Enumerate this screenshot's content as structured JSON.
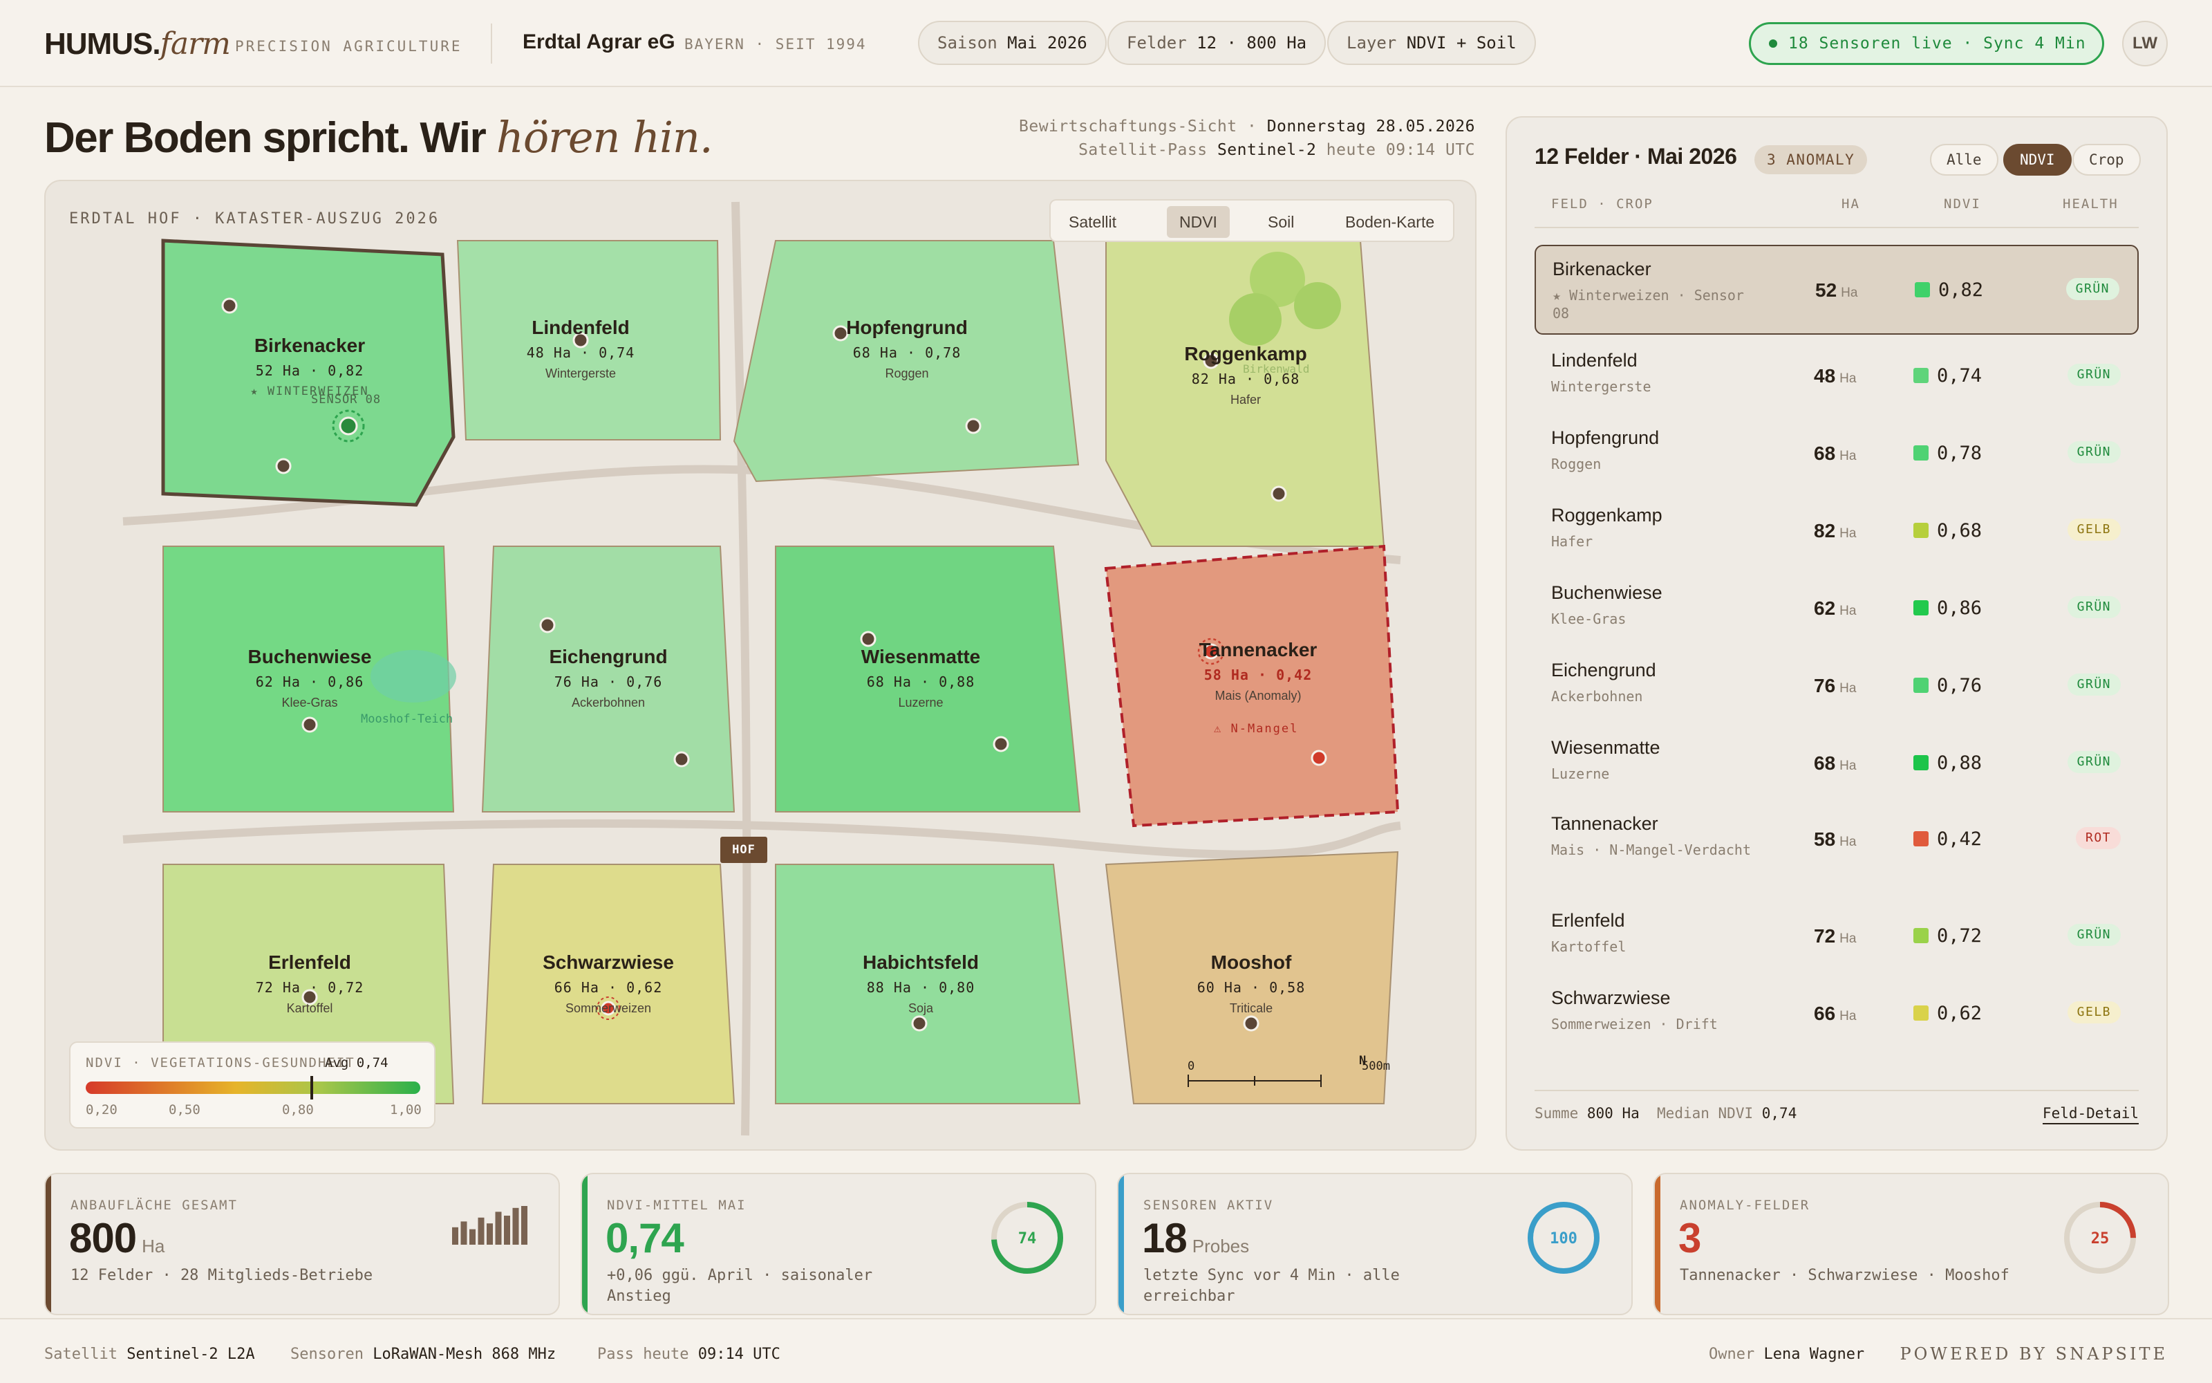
{
  "brand": {
    "name": "HUMUS.",
    "name_italic": "farm",
    "tagline": "PRECISION AGRICULTURE"
  },
  "org": {
    "name": "Erdtal Agrar eG",
    "sub": "BAYERN · SEIT 1994"
  },
  "pills": [
    {
      "label": "Saison",
      "value": "Mai 2026"
    },
    {
      "label": "Felder",
      "value": "12 · 800 Ha"
    },
    {
      "label": "Layer",
      "value": "NDVI + Soil"
    }
  ],
  "live_status": "18 Sensoren live · Sync 4 Min",
  "user_initials": "LW",
  "headline": {
    "main": "Der Boden spricht. Wir ",
    "italic": "hören hin."
  },
  "meta": {
    "line1_label": "Bewirtschaftungs-Sicht ·",
    "line1_value": "Donnerstag 28.05.2026",
    "line2_label": "Satellit-Pass",
    "line2_value": "Sentinel-2",
    "line2_suffix": "heute 09:14 UTC"
  },
  "map": {
    "title": "ERDTAL HOF · KATASTER-AUSZUG 2026",
    "layers": [
      "Satellit",
      "NDVI",
      "Soil",
      "Boden-Karte"
    ],
    "active_layer": "NDVI",
    "hof_label": "HOF",
    "pond_label": "Mooshof-Teich",
    "forest_label": "Birkenwald",
    "sensor_label": "SENSOR 08",
    "anomaly_note": "⚠ N-Mangel",
    "scale": {
      "start": "0",
      "end": "500m",
      "north": "N"
    },
    "fields": [
      {
        "name": "Birkenacker",
        "data": "52 Ha · 0,82",
        "crop": "★ WINTERWEIZEN",
        "color": "#7dd98f"
      },
      {
        "name": "Lindenfeld",
        "data": "48 Ha · 0,74",
        "crop": "Wintergerste",
        "color": "#a4e0a8"
      },
      {
        "name": "Hopfengrund",
        "data": "68 Ha · 0,78",
        "crop": "Roggen",
        "color": "#9fdea3"
      },
      {
        "name": "Roggenkamp",
        "data": "82 Ha · 0,68",
        "crop": "Hafer",
        "color": "#d2df95"
      },
      {
        "name": "Buchenwiese",
        "data": "62 Ha · 0,86",
        "crop": "Klee-Gras",
        "color": "#74d985"
      },
      {
        "name": "Eichengrund",
        "data": "76 Ha · 0,76",
        "crop": "Ackerbohnen",
        "color": "#a2dda6"
      },
      {
        "name": "Wiesenmatte",
        "data": "68 Ha · 0,88",
        "crop": "Luzerne",
        "color": "#70d582"
      },
      {
        "name": "Tannenacker",
        "data": "58 Ha · 0,42",
        "crop": "Mais (Anomaly)",
        "color": "#e2997e"
      },
      {
        "name": "Erlenfeld",
        "data": "72 Ha · 0,72",
        "crop": "Kartoffel",
        "color": "#c8df92"
      },
      {
        "name": "Schwarzwiese",
        "data": "66 Ha · 0,62",
        "crop": "Sommerweizen",
        "color": "#dedc8c"
      },
      {
        "name": "Habichtsfeld",
        "data": "88 Ha · 0,80",
        "crop": "Soja",
        "color": "#92dd9c"
      },
      {
        "name": "Mooshof",
        "data": "60 Ha · 0,58",
        "crop": "Triticale",
        "color": "#e1c48f"
      }
    ],
    "legend": {
      "title": "NDVI · VEGETATIONS-GESUNDHEIT",
      "avg": "Avg 0,74",
      "avg_value": 0.74,
      "ticks": [
        "0,20",
        "0,50",
        "0,80",
        "1,00"
      ]
    }
  },
  "panel": {
    "title": "12 Felder · Mai 2026",
    "badge": "3 ANOMALY",
    "tabs": [
      "Alle",
      "NDVI",
      "Crop"
    ],
    "active_tab": "NDVI",
    "columns": [
      "FELD · CROP",
      "HA",
      "NDVI",
      "HEALTH"
    ],
    "rows": [
      {
        "name": "Birkenacker",
        "crop": "★ Winterweizen · Sensor 08",
        "ha": "52",
        "unit": "Ha",
        "ndvi": "0,82",
        "swatch": "#3fd16a",
        "health": "GRÜN",
        "tone": "g",
        "selected": true
      },
      {
        "name": "Lindenfeld",
        "crop": "Wintergerste",
        "ha": "48",
        "unit": "Ha",
        "ndvi": "0,74",
        "swatch": "#5fd47a",
        "health": "GRÜN",
        "tone": "g"
      },
      {
        "name": "Hopfengrund",
        "crop": "Roggen",
        "ha": "68",
        "unit": "Ha",
        "ndvi": "0,78",
        "swatch": "#4fd273",
        "health": "GRÜN",
        "tone": "g"
      },
      {
        "name": "Roggenkamp",
        "crop": "Hafer",
        "ha": "82",
        "unit": "Ha",
        "ndvi": "0,68",
        "swatch": "#b6cf3c",
        "health": "GELB",
        "tone": "y"
      },
      {
        "name": "Buchenwiese",
        "crop": "Klee-Gras",
        "ha": "62",
        "unit": "Ha",
        "ndvi": "0,86",
        "swatch": "#22c94d",
        "health": "GRÜN",
        "tone": "g"
      },
      {
        "name": "Eichengrund",
        "crop": "Ackerbohnen",
        "ha": "76",
        "unit": "Ha",
        "ndvi": "0,76",
        "swatch": "#4fd273",
        "health": "GRÜN",
        "tone": "g"
      },
      {
        "name": "Wiesenmatte",
        "crop": "Luzerne",
        "ha": "68",
        "unit": "Ha",
        "ndvi": "0,88",
        "swatch": "#1dc44a",
        "health": "GRÜN",
        "tone": "g"
      },
      {
        "name": "Tannenacker",
        "crop": "Mais · N-Mangel-Verdacht",
        "ha": "58",
        "unit": "Ha",
        "ndvi": "0,42",
        "swatch": "#e05a3c",
        "health": "ROT",
        "tone": "r"
      },
      {
        "name": "Erlenfeld",
        "crop": "Kartoffel",
        "ha": "72",
        "unit": "Ha",
        "ndvi": "0,72",
        "swatch": "#9ad24a",
        "health": "GRÜN",
        "tone": "g"
      },
      {
        "name": "Schwarzwiese",
        "crop": "Sommerweizen · Drift",
        "ha": "66",
        "unit": "Ha",
        "ndvi": "0,62",
        "swatch": "#d9d24a",
        "health": "GELB",
        "tone": "y"
      }
    ],
    "footer": {
      "sum_label": "Summe",
      "sum_value": "800 Ha",
      "median_label": "Median NDVI",
      "median_value": "0,74",
      "link": "Feld-Detail"
    }
  },
  "kpis": [
    {
      "label": "ANBAUFLÄCHE GESAMT",
      "value": "800",
      "unit": "Ha",
      "sub": "12 Felder · 28 Mitglieds-Betriebe",
      "accent": "#6b4a30",
      "bars": [
        0.45,
        0.6,
        0.4,
        0.7,
        0.55,
        0.85,
        0.75,
        0.95,
        1.0
      ]
    },
    {
      "label": "NDVI-MITTEL MAI",
      "value": "0,74",
      "unit": "",
      "sub": "+0,06 ggü. April · saisonaler Anstieg",
      "accent": "#2ea44f",
      "ring_value": "74",
      "ring_fraction": 0.74
    },
    {
      "label": "SENSOREN AKTIV",
      "value": "18",
      "unit": "Probes",
      "sub": "letzte Sync vor 4 Min · alle erreichbar",
      "accent": "#3a9ec9",
      "ring_value": "100",
      "ring_fraction": 1.0
    },
    {
      "label": "ANOMALY-FELDER",
      "value": "3",
      "unit": "",
      "sub": "Tannenacker · Schwarzwiese · Mooshof",
      "accent": "#c9402e",
      "ring_value": "25",
      "ring_fraction": 0.25
    }
  ],
  "footer": {
    "items": [
      {
        "label": "Satellit",
        "value": "Sentinel-2 L2A"
      },
      {
        "label": "Sensoren",
        "value": "LoRaWAN-Mesh 868 MHz"
      },
      {
        "label": "Pass heute",
        "value": "09:14 UTC"
      }
    ],
    "owner_label": "Owner",
    "owner_value": "Lena Wagner",
    "powered": "POWERED BY SNAPSITE"
  }
}
